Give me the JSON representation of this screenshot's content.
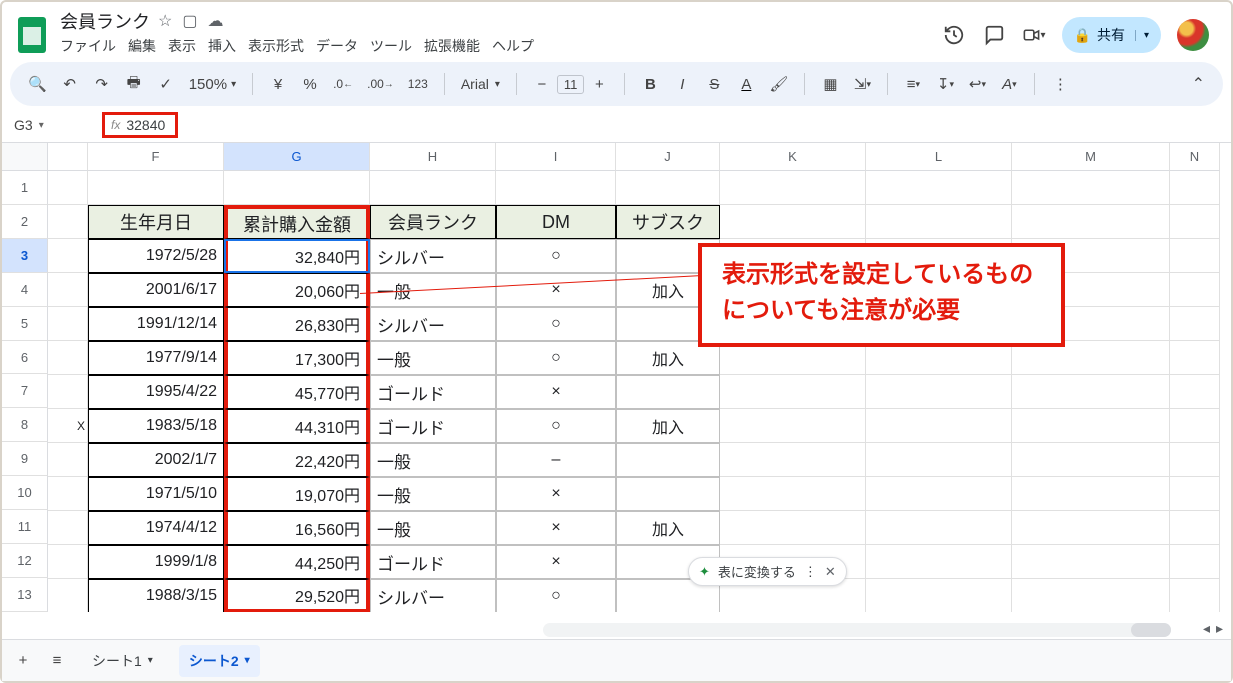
{
  "doc_title": "会員ランク",
  "menu": {
    "file": "ファイル",
    "edit": "編集",
    "view": "表示",
    "insert": "挿入",
    "format": "表示形式",
    "data": "データ",
    "tools": "ツール",
    "extensions": "拡張機能",
    "help": "ヘルプ"
  },
  "share": {
    "label": "共有"
  },
  "toolbar": {
    "zoom": "150%",
    "currency": "¥",
    "percent": "%",
    "dec0": ".0",
    "dec1": ".00",
    "n123": "123",
    "font": "Arial",
    "size": "11",
    "minus": "−",
    "plus": "+",
    "bold": "B",
    "italic": "I",
    "strike": "S",
    "more": "⋮"
  },
  "namebox": "G3",
  "formula": "32840",
  "cols": {
    "stub": "",
    "F": "F",
    "G": "G",
    "H": "H",
    "I": "I",
    "J": "J",
    "K": "K",
    "L": "L",
    "M": "M",
    "N": "N"
  },
  "rows_no": [
    "1",
    "2",
    "3",
    "4",
    "5",
    "6",
    "7",
    "8",
    "9",
    "10",
    "11",
    "12",
    "13"
  ],
  "stub3": "X",
  "headers": {
    "F": "生年月日",
    "G": "累計購入金額",
    "H": "会員ランク",
    "I": "DM",
    "J": "サブスク"
  },
  "rows": [
    {
      "F": "1972/5/28",
      "G": "32,840円",
      "H": "シルバー",
      "I": "○",
      "J": ""
    },
    {
      "F": "2001/6/17",
      "G": "20,060円",
      "H": "一般",
      "I": "×",
      "J": "加入"
    },
    {
      "F": "1991/12/14",
      "G": "26,830円",
      "H": "シルバー",
      "I": "○",
      "J": ""
    },
    {
      "F": "1977/9/14",
      "G": "17,300円",
      "H": "一般",
      "I": "○",
      "J": "加入"
    },
    {
      "F": "1995/4/22",
      "G": "45,770円",
      "H": "ゴールド",
      "I": "×",
      "J": ""
    },
    {
      "F": "1983/5/18",
      "G": "44,310円",
      "H": "ゴールド",
      "I": "○",
      "J": "加入"
    },
    {
      "F": "2002/1/7",
      "G": "22,420円",
      "H": "一般",
      "I": "–",
      "J": ""
    },
    {
      "F": "1971/5/10",
      "G": "19,070円",
      "H": "一般",
      "I": "×",
      "J": ""
    },
    {
      "F": "1974/4/12",
      "G": "16,560円",
      "H": "一般",
      "I": "×",
      "J": "加入"
    },
    {
      "F": "1999/1/8",
      "G": "44,250円",
      "H": "ゴールド",
      "I": "×",
      "J": ""
    },
    {
      "F": "1988/3/15",
      "G": "29,520円",
      "H": "シルバー",
      "I": "○",
      "J": ""
    }
  ],
  "anno": {
    "line1": "表示形式を設定しているもの",
    "line2": "についても注意が必要"
  },
  "chip": {
    "text": "表に変換する"
  },
  "tabs": {
    "add": "+",
    "all": "≡",
    "s1": "シート1",
    "s2": "シート2"
  }
}
